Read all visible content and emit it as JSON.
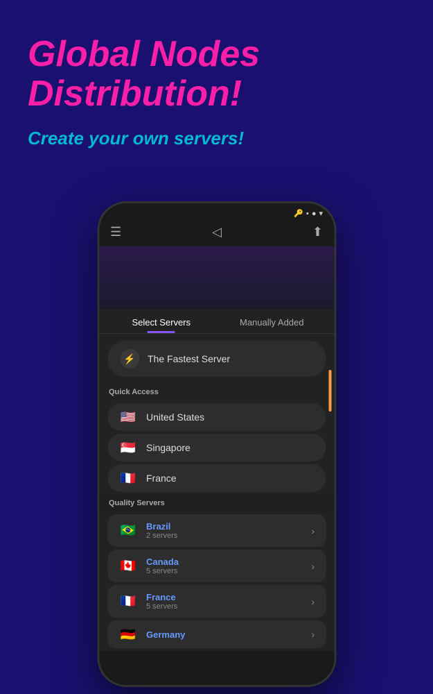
{
  "hero": {
    "main_title": "Global Nodes Distribution!",
    "sub_title": "Create your own servers!"
  },
  "phone": {
    "status_bar": {
      "icons": [
        "key",
        "square",
        "dot",
        "signal"
      ]
    },
    "app_bar": {
      "menu_icon": "☰",
      "logo_icon": "◁",
      "share_icon": "⬆"
    },
    "tabs": [
      {
        "label": "Select Servers",
        "active": true
      },
      {
        "label": "Manually Added",
        "active": false
      }
    ],
    "fastest_server": {
      "label": "The Fastest Server",
      "icon": "⚡"
    },
    "quick_access_label": "Quick Access",
    "quick_access_servers": [
      {
        "country": "United States",
        "flag": "🇺🇸"
      },
      {
        "country": "Singapore",
        "flag": "🇸🇬"
      },
      {
        "country": "France",
        "flag": "🇫🇷"
      }
    ],
    "quality_servers_label": "Quality Servers",
    "quality_servers": [
      {
        "country": "Brazil",
        "servers": "2 servers",
        "flag": "🇧🇷"
      },
      {
        "country": "Canada",
        "servers": "5 servers",
        "flag": "🇨🇦"
      },
      {
        "country": "France",
        "servers": "5 servers",
        "flag": "🇫🇷"
      },
      {
        "country": "Germany",
        "servers": "",
        "flag": "🇩🇪"
      }
    ]
  }
}
